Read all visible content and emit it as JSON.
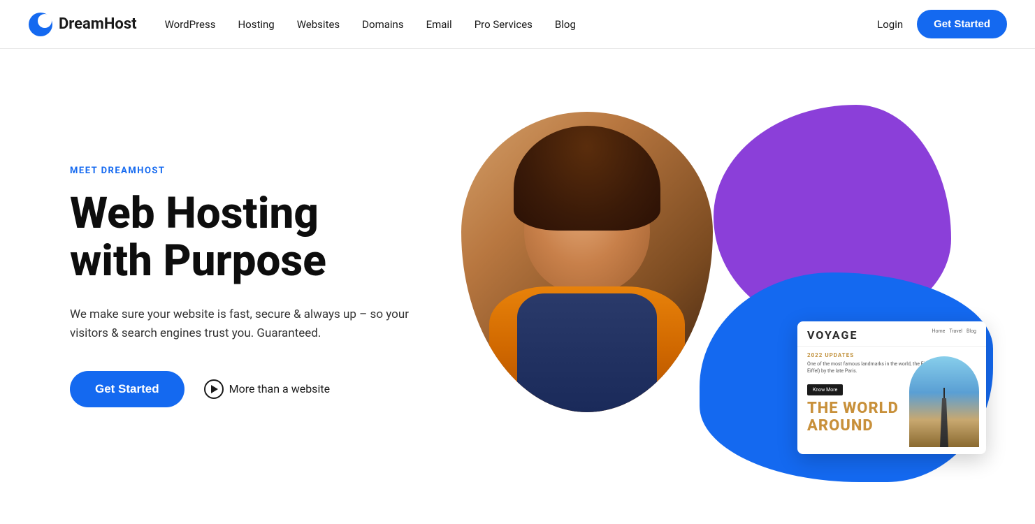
{
  "brand": {
    "name": "DreamHost",
    "logo_alt": "DreamHost logo"
  },
  "nav": {
    "links": [
      {
        "id": "wordpress",
        "label": "WordPress"
      },
      {
        "id": "hosting",
        "label": "Hosting"
      },
      {
        "id": "websites",
        "label": "Websites"
      },
      {
        "id": "domains",
        "label": "Domains"
      },
      {
        "id": "email",
        "label": "Email"
      },
      {
        "id": "pro-services",
        "label": "Pro Services"
      },
      {
        "id": "blog",
        "label": "Blog"
      }
    ],
    "login_label": "Login",
    "cta_label": "Get Started"
  },
  "hero": {
    "eyebrow": "MEET DREAMHOST",
    "title_line1": "Web Hosting",
    "title_line2": "with Purpose",
    "subtitle": "We make sure your website is fast, secure & always up – so your visitors & search engines trust you. Guaranteed.",
    "cta_label": "Get Started",
    "secondary_label": "More than a website"
  },
  "card": {
    "site_name": "VOYAGE",
    "nav_items": [
      "Home",
      "Travel",
      "Blog"
    ],
    "tag": "2022 UPDATES",
    "description": "One of the most famous landmarks in the world, the Eiffel Tower (in Tour Eiffel) by the late Paris.",
    "know_more": "Know More",
    "big_text": "THE WORLD",
    "big_text2": "AROUND"
  }
}
